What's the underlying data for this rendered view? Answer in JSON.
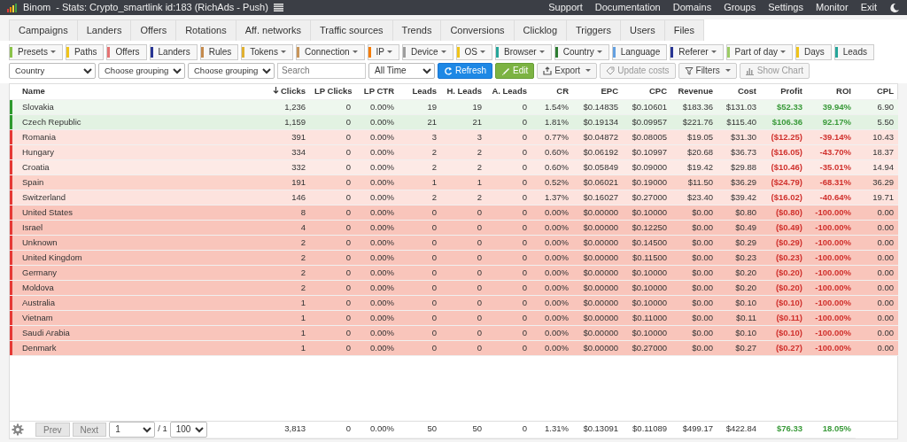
{
  "topbar": {
    "app": "Binom",
    "title": "- Stats: Crypto_smartlink id:183 (RichAds - Push)",
    "links": [
      "Support",
      "Documentation",
      "Domains",
      "Groups",
      "Settings",
      "Monitor",
      "Exit"
    ]
  },
  "tabs": [
    "Campaigns",
    "Landers",
    "Offers",
    "Rotations",
    "Aff. networks",
    "Traffic sources",
    "Trends",
    "Conversions",
    "Clicklog",
    "Triggers",
    "Users",
    "Files"
  ],
  "filters": [
    {
      "label": "Presets",
      "color": "#8bc34a",
      "dropdown": true
    },
    {
      "label": "Paths",
      "color": "#f0c419",
      "dropdown": false
    },
    {
      "label": "Offers",
      "color": "#e57373",
      "dropdown": false
    },
    {
      "label": "Landers",
      "color": "#283593",
      "dropdown": false
    },
    {
      "label": "Rules",
      "color": "#c48a4c",
      "dropdown": false
    },
    {
      "label": "Tokens",
      "color": "#e0b030",
      "dropdown": true
    },
    {
      "label": "Connection",
      "color": "#c8955a",
      "dropdown": true
    },
    {
      "label": "IP",
      "color": "#f57c00",
      "dropdown": true
    },
    {
      "label": "Device",
      "color": "#9e9e9e",
      "dropdown": true
    },
    {
      "label": "OS",
      "color": "#f0c419",
      "dropdown": true
    },
    {
      "label": "Browser",
      "color": "#26a69a",
      "dropdown": true
    },
    {
      "label": "Country",
      "color": "#2e7d32",
      "dropdown": true
    },
    {
      "label": "Language",
      "color": "#64a0e0",
      "dropdown": false
    },
    {
      "label": "Referer",
      "color": "#283593",
      "dropdown": true
    },
    {
      "label": "Part of day",
      "color": "#9ccc65",
      "dropdown": true
    },
    {
      "label": "Days",
      "color": "#f0c419",
      "dropdown": false
    },
    {
      "label": "Leads",
      "color": "#26a69a",
      "dropdown": false
    }
  ],
  "toolbar": {
    "groupings": [
      "Country",
      "Choose grouping",
      "Choose grouping"
    ],
    "search": {
      "placeholder": "Search"
    },
    "period": "All Time",
    "buttons": [
      {
        "label": "Refresh",
        "kind": "refresh",
        "disabled": false
      },
      {
        "label": "Edit",
        "kind": "edit",
        "disabled": false
      },
      {
        "label": "Export",
        "kind": "export",
        "disabled": false
      },
      {
        "label": "Update costs",
        "kind": "update",
        "disabled": true
      },
      {
        "label": "Filters",
        "kind": "filters",
        "disabled": false
      },
      {
        "label": "Show Chart",
        "kind": "chart",
        "disabled": true
      }
    ]
  },
  "table": {
    "columns": [
      {
        "label": "Name",
        "sorted": false
      },
      {
        "label": "Clicks",
        "sorted": true
      },
      {
        "label": "LP Clicks",
        "sorted": false
      },
      {
        "label": "LP CTR",
        "sorted": false
      },
      {
        "label": "Leads",
        "sorted": false
      },
      {
        "label": "H. Leads",
        "sorted": false
      },
      {
        "label": "A. Leads",
        "sorted": false
      },
      {
        "label": "CR",
        "sorted": false
      },
      {
        "label": "EPC",
        "sorted": false
      },
      {
        "label": "CPC",
        "sorted": false
      },
      {
        "label": "Revenue",
        "sorted": false
      },
      {
        "label": "Cost",
        "sorted": false
      },
      {
        "label": "Profit",
        "sorted": false
      },
      {
        "label": "ROI",
        "sorted": false
      },
      {
        "label": "CPL",
        "sorted": false
      }
    ],
    "rows": [
      {
        "profitable": true,
        "color": "#eef7ee",
        "cells": [
          "Slovakia",
          "1,236",
          "0",
          "0.00%",
          "19",
          "19",
          "0",
          "1.54%",
          "$0.14835",
          "$0.10601",
          "$183.36",
          "$131.03",
          "$52.33",
          "39.94%",
          "6.90"
        ]
      },
      {
        "profitable": true,
        "color": "#e2f2e2",
        "cells": [
          "Czech Republic",
          "1,159",
          "0",
          "0.00%",
          "21",
          "21",
          "0",
          "1.81%",
          "$0.19134",
          "$0.09957",
          "$221.76",
          "$115.40",
          "$106.36",
          "92.17%",
          "5.50"
        ]
      },
      {
        "profitable": false,
        "color": "#fde3de",
        "cells": [
          "Romania",
          "391",
          "0",
          "0.00%",
          "3",
          "3",
          "0",
          "0.77%",
          "$0.04872",
          "$0.08005",
          "$19.05",
          "$31.30",
          "($12.25)",
          "-39.14%",
          "10.43"
        ]
      },
      {
        "profitable": false,
        "color": "#fde3de",
        "cells": [
          "Hungary",
          "334",
          "0",
          "0.00%",
          "2",
          "2",
          "0",
          "0.60%",
          "$0.06192",
          "$0.10997",
          "$20.68",
          "$36.73",
          "($16.05)",
          "-43.70%",
          "18.37"
        ]
      },
      {
        "profitable": false,
        "color": "#fdeae6",
        "cells": [
          "Croatia",
          "332",
          "0",
          "0.00%",
          "2",
          "2",
          "0",
          "0.60%",
          "$0.05849",
          "$0.09000",
          "$19.42",
          "$29.88",
          "($10.46)",
          "-35.01%",
          "14.94"
        ]
      },
      {
        "profitable": false,
        "color": "#fcd3ca",
        "cells": [
          "Spain",
          "191",
          "0",
          "0.00%",
          "1",
          "1",
          "0",
          "0.52%",
          "$0.06021",
          "$0.19000",
          "$11.50",
          "$36.29",
          "($24.79)",
          "-68.31%",
          "36.29"
        ]
      },
      {
        "profitable": false,
        "color": "#fde3de",
        "cells": [
          "Switzerland",
          "146",
          "0",
          "0.00%",
          "2",
          "2",
          "0",
          "1.37%",
          "$0.16027",
          "$0.27000",
          "$23.40",
          "$39.42",
          "($16.02)",
          "-40.64%",
          "19.71"
        ]
      },
      {
        "profitable": false,
        "color": "#f9c5bb",
        "cells": [
          "United States",
          "8",
          "0",
          "0.00%",
          "0",
          "0",
          "0",
          "0.00%",
          "$0.00000",
          "$0.10000",
          "$0.00",
          "$0.80",
          "($0.80)",
          "-100.00%",
          "0.00"
        ]
      },
      {
        "profitable": false,
        "color": "#f9c5bb",
        "cells": [
          "Israel",
          "4",
          "0",
          "0.00%",
          "0",
          "0",
          "0",
          "0.00%",
          "$0.00000",
          "$0.12250",
          "$0.00",
          "$0.49",
          "($0.49)",
          "-100.00%",
          "0.00"
        ]
      },
      {
        "profitable": false,
        "color": "#f9c5bb",
        "cells": [
          "Unknown",
          "2",
          "0",
          "0.00%",
          "0",
          "0",
          "0",
          "0.00%",
          "$0.00000",
          "$0.14500",
          "$0.00",
          "$0.29",
          "($0.29)",
          "-100.00%",
          "0.00"
        ]
      },
      {
        "profitable": false,
        "color": "#f9c5bb",
        "cells": [
          "United Kingdom",
          "2",
          "0",
          "0.00%",
          "0",
          "0",
          "0",
          "0.00%",
          "$0.00000",
          "$0.11500",
          "$0.00",
          "$0.23",
          "($0.23)",
          "-100.00%",
          "0.00"
        ]
      },
      {
        "profitable": false,
        "color": "#f9c5bb",
        "cells": [
          "Germany",
          "2",
          "0",
          "0.00%",
          "0",
          "0",
          "0",
          "0.00%",
          "$0.00000",
          "$0.10000",
          "$0.00",
          "$0.20",
          "($0.20)",
          "-100.00%",
          "0.00"
        ]
      },
      {
        "profitable": false,
        "color": "#f9c5bb",
        "cells": [
          "Moldova",
          "2",
          "0",
          "0.00%",
          "0",
          "0",
          "0",
          "0.00%",
          "$0.00000",
          "$0.10000",
          "$0.00",
          "$0.20",
          "($0.20)",
          "-100.00%",
          "0.00"
        ]
      },
      {
        "profitable": false,
        "color": "#f9c5bb",
        "cells": [
          "Australia",
          "1",
          "0",
          "0.00%",
          "0",
          "0",
          "0",
          "0.00%",
          "$0.00000",
          "$0.10000",
          "$0.00",
          "$0.10",
          "($0.10)",
          "-100.00%",
          "0.00"
        ]
      },
      {
        "profitable": false,
        "color": "#f9c5bb",
        "cells": [
          "Vietnam",
          "1",
          "0",
          "0.00%",
          "0",
          "0",
          "0",
          "0.00%",
          "$0.00000",
          "$0.11000",
          "$0.00",
          "$0.11",
          "($0.11)",
          "-100.00%",
          "0.00"
        ]
      },
      {
        "profitable": false,
        "color": "#f9c5bb",
        "cells": [
          "Saudi Arabia",
          "1",
          "0",
          "0.00%",
          "0",
          "0",
          "0",
          "0.00%",
          "$0.00000",
          "$0.10000",
          "$0.00",
          "$0.10",
          "($0.10)",
          "-100.00%",
          "0.00"
        ]
      },
      {
        "profitable": false,
        "color": "#f9c5bb",
        "cells": [
          "Denmark",
          "1",
          "0",
          "0.00%",
          "0",
          "0",
          "0",
          "0.00%",
          "$0.00000",
          "$0.27000",
          "$0.00",
          "$0.27",
          "($0.27)",
          "-100.00%",
          "0.00"
        ]
      }
    ],
    "totals": {
      "profitable": true,
      "cells": [
        "",
        "3,813",
        "0",
        "0.00%",
        "50",
        "50",
        "0",
        "1.31%",
        "$0.13091",
        "$0.11089",
        "$499.17",
        "$422.84",
        "$76.33",
        "18.05%"
      ]
    }
  },
  "pagination": {
    "prev": "Prev",
    "next": "Next",
    "page": "1",
    "pages": "/ 1",
    "per_page": "100"
  }
}
